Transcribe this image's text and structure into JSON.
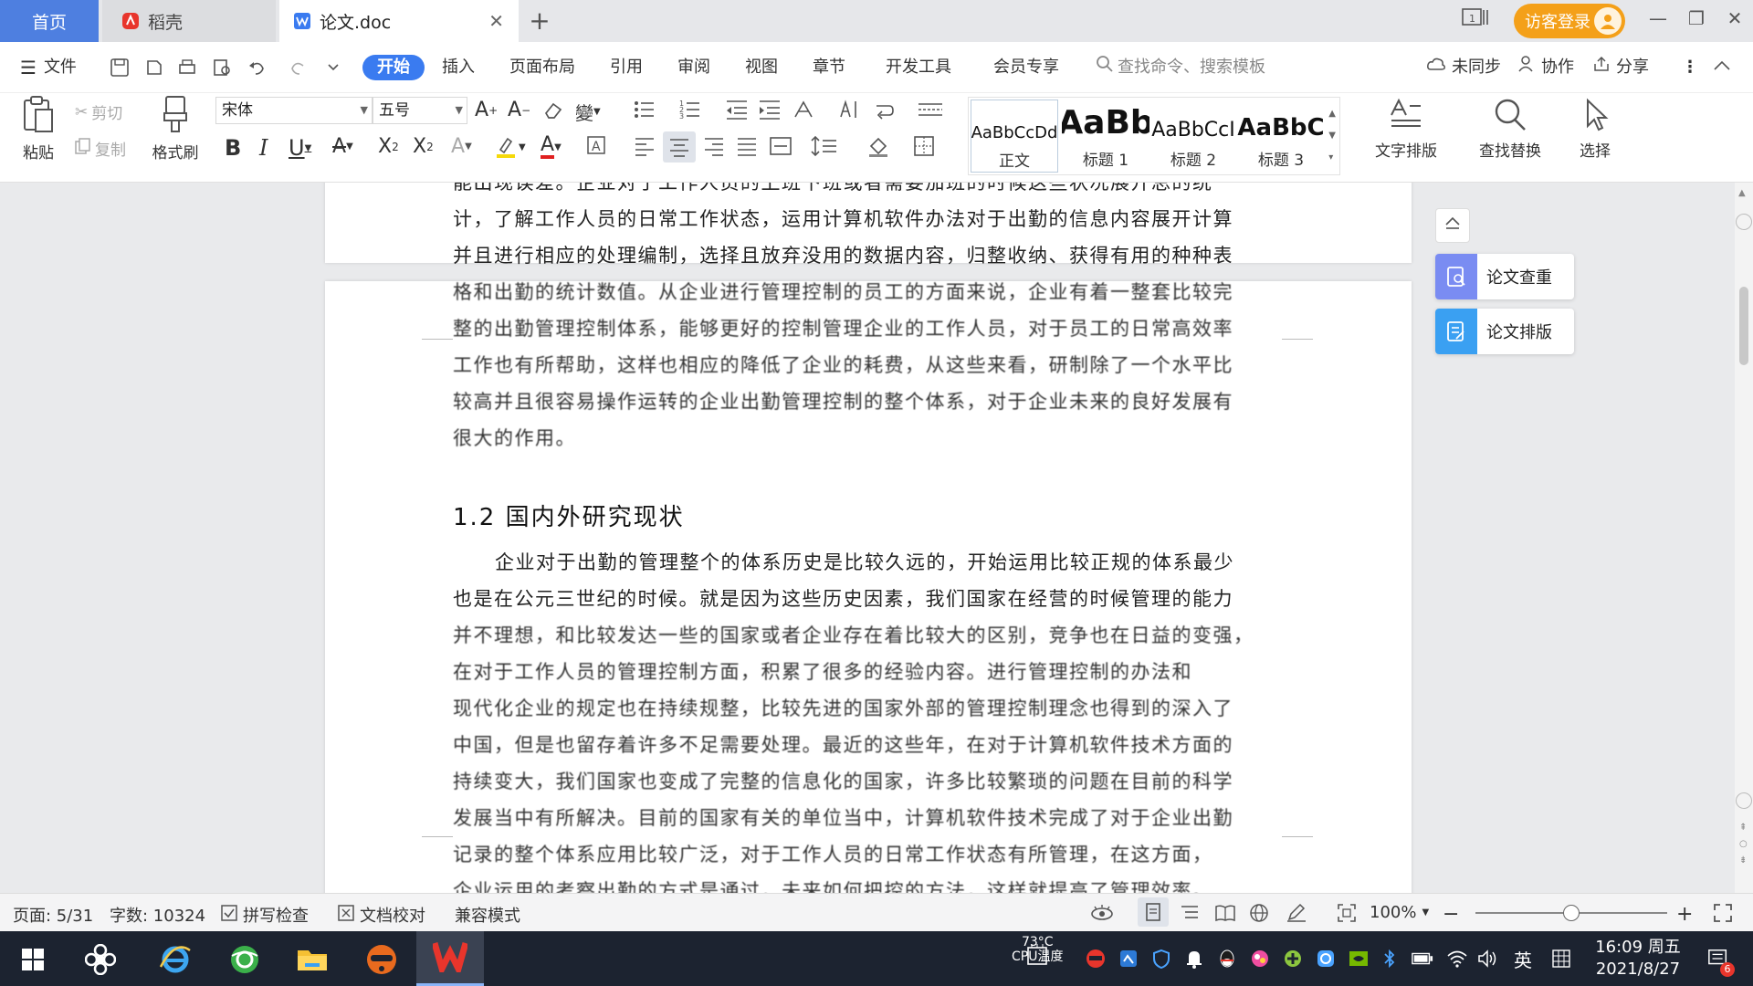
{
  "titlebar": {
    "tabs": [
      {
        "label": "首页",
        "icon": "home"
      },
      {
        "label": "稻壳",
        "icon": "docer-icon"
      },
      {
        "label": "论文.doc",
        "icon": "word-doc-icon"
      }
    ],
    "login_label": "访客登录"
  },
  "menubar": {
    "file_label": "文件",
    "items": [
      "开始",
      "插入",
      "页面布局",
      "引用",
      "审阅",
      "视图",
      "章节",
      "开发工具",
      "会员专享"
    ],
    "active": "开始",
    "search_placeholder": "查找命令、搜索模板",
    "sync_label": "未同步",
    "collab_label": "协作",
    "share_label": "分享"
  },
  "ribbon": {
    "paste_label": "粘贴",
    "cut_label": "剪切",
    "copy_label": "复制",
    "format_painter_label": "格式刷",
    "font_name": "宋体",
    "font_size": "五号",
    "styles": [
      {
        "preview": "AaBbCcDd",
        "name": "正文"
      },
      {
        "preview": "AaBb",
        "name": "标题 1"
      },
      {
        "preview": "AaBbCcI",
        "name": "标题 2"
      },
      {
        "preview": "AaBbC",
        "name": "标题 3"
      }
    ],
    "text_layout_label": "文字排版",
    "find_replace_label": "查找替换",
    "select_label": "选择"
  },
  "document": {
    "paragraph_top": [
      "能出现误差。企业对于工作人员的上班下班或者需要加班的时候这些状况展开总的统",
      "计，了解工作人员的日常工作状态，运用计算机软件办法对于出勤的信息内容展开计算",
      "并且进行相应的处理编制，选择且放弃没用的数据内容，归整收纳、获得有用的种种表",
      "格和出勤的统计数值。从企业进行管理控制的员工的方面来说，企业有着一整套比较完",
      "整的出勤管理控制体系，能够更好的控制管理企业的工作人员，对于员工的日常高效率",
      "工作也有所帮助，这样也相应的降低了企业的耗费，从这些来看，研制除了一个水平比",
      "较高并且很容易操作运转的企业出勤管理控制的整个体系，对于企业未来的良好发展有",
      "很大的作用。"
    ],
    "heading": "1.2 国内外研究现状",
    "paragraph_bottom": [
      "企业对于出勤的管理整个的体系历史是比较久远的，开始运用比较正规的体系最少",
      "也是在公元三世纪的时候。就是因为这些历史因素，我们国家在经营的时候管理的能力",
      "并不理想，和比较发达一些的国家或者企业存在着比较大的区别，竞争也在日益的变强，",
      "在对于工作人员的管理控制方面，积累了很多的经验内容。进行管理控制的办法和",
      "现代化企业的规定也在持续规整，比较先进的国家外部的管理控制理念也得到的深入了",
      "中国，但是也留存着许多不足需要处理。最近的这些年，在对于计算机软件技术方面的",
      "持续变大，我们国家也变成了完整的信息化的国家，许多比较繁琐的问题在目前的科学",
      "发展当中有所解决。目前的国家有关的单位当中，计算机软件技术完成了对于企业出勤",
      "记录的整个体系应用比较广泛，对于工作人员的日常工作状态有所管理，在这方面，",
      "企业运用的考察出勤的方式是通过，未来如何把控的方法，这样就提高了管理效率。"
    ]
  },
  "sidepanel": {
    "check_label": "论文查重",
    "layout_label": "论文排版"
  },
  "statusbar": {
    "page_label": "页面: 5/31",
    "word_count": "字数: 10324",
    "spell_check": "拼写检查",
    "doc_proofread": "文档校对",
    "compat_mode": "兼容模式",
    "zoom": "100%"
  },
  "taskbar": {
    "temp": "73°C",
    "temp_label": "CPU温度",
    "ime": "英",
    "time": "16:09 周五",
    "date": "2021/8/27",
    "notification_count": "6"
  },
  "colors": {
    "accent": "#3a7bf0",
    "home_tab": "#4e7fe0",
    "login": "#f4a019",
    "wps_red": "#e8352c"
  }
}
